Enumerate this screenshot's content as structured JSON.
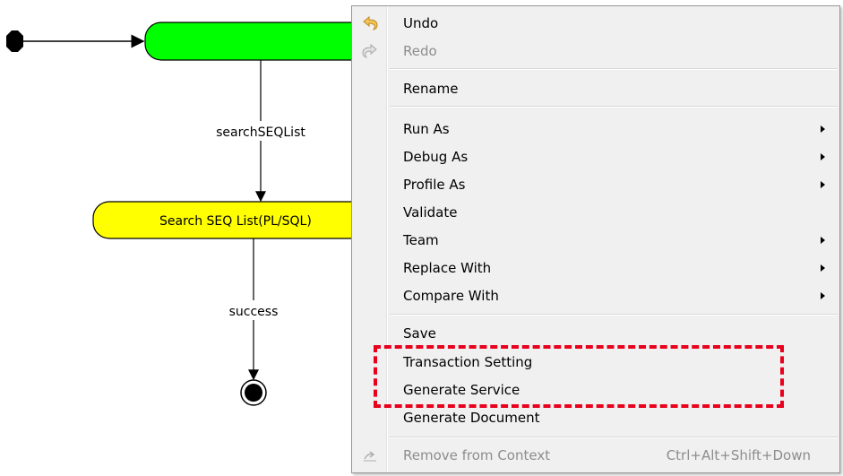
{
  "diagram": {
    "start_state_label": "",
    "transition_1": "searchSEQList",
    "activity_1": "Search SEQ List(PL/SQL)",
    "transition_2": "success",
    "colors": {
      "top_activity": "#00ff00",
      "activity": "#ffff00",
      "highlight": "#e8001c"
    }
  },
  "context_menu": {
    "items": [
      {
        "label": "Undo",
        "icon": "undo-icon",
        "enabled": true
      },
      {
        "label": "Redo",
        "icon": "redo-icon",
        "enabled": false
      },
      {
        "label": "Rename",
        "enabled": true
      },
      {
        "label": "Run As",
        "submenu": true,
        "enabled": true
      },
      {
        "label": "Debug As",
        "submenu": true,
        "enabled": true
      },
      {
        "label": "Profile As",
        "submenu": true,
        "enabled": true
      },
      {
        "label": "Validate",
        "enabled": true
      },
      {
        "label": "Team",
        "submenu": true,
        "enabled": true
      },
      {
        "label": "Replace With",
        "submenu": true,
        "enabled": true
      },
      {
        "label": "Compare With",
        "submenu": true,
        "enabled": true
      },
      {
        "label": "Save",
        "enabled": true
      },
      {
        "label": "Transaction Setting",
        "enabled": true
      },
      {
        "label": "Generate Service",
        "enabled": true
      },
      {
        "label": "Generate Document",
        "enabled": true
      },
      {
        "label": "Remove from Context",
        "shortcut": "Ctrl+Alt+Shift+Down",
        "icon": "remove-context-icon",
        "enabled": false
      }
    ]
  }
}
